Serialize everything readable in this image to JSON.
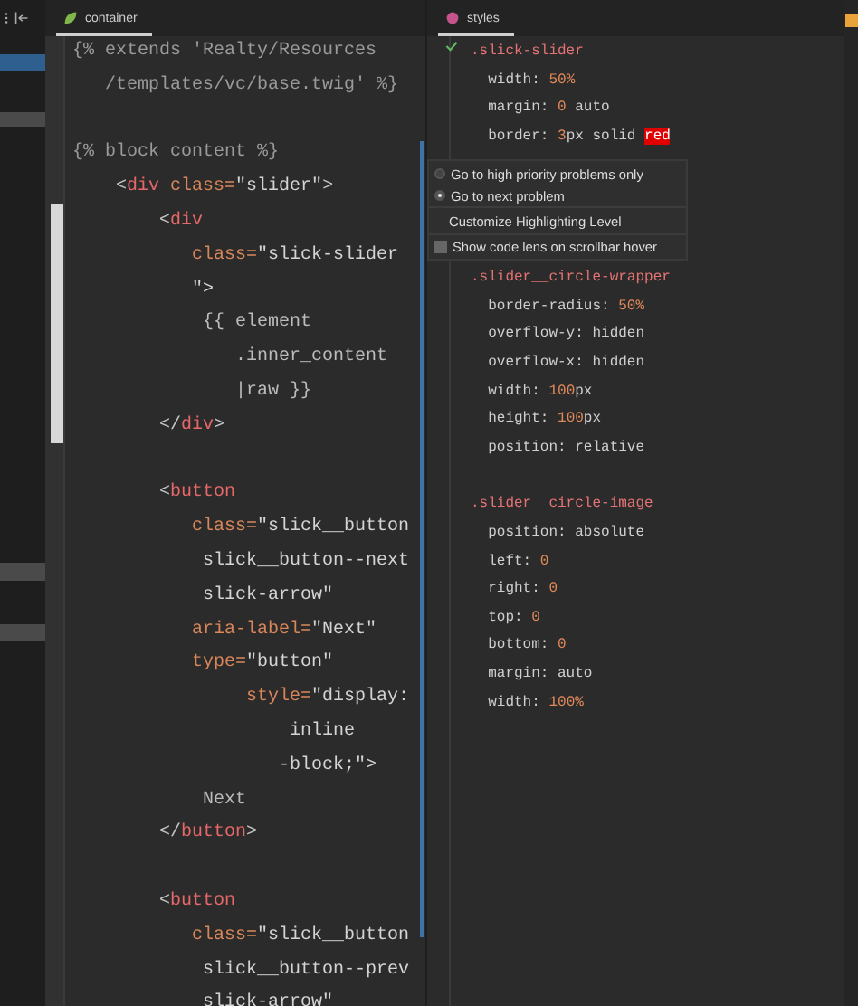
{
  "left_editor": {
    "tab": {
      "label": "container",
      "selected": true
    },
    "lines": [
      [
        {
          "kind": "twig",
          "text": "{% extends 'Realty/Resources"
        }
      ],
      [
        {
          "kind": "twig",
          "text": "   /templates/vc/base.twig' %}"
        }
      ],
      [
        {
          "kind": "blank"
        }
      ],
      [
        {
          "kind": "twig",
          "text": "{% block content %}"
        }
      ],
      [
        {
          "kind": "punct",
          "text": "    <"
        },
        {
          "kind": "tag",
          "text": "div"
        },
        {
          "kind": "attr",
          "text": " class="
        },
        {
          "kind": "str",
          "text": "\"slider\""
        },
        {
          "kind": "punct",
          "text": ">"
        }
      ],
      [
        {
          "kind": "punct",
          "text": "        <"
        },
        {
          "kind": "tag",
          "text": "div"
        }
      ],
      [
        {
          "kind": "attr",
          "text": "           class="
        },
        {
          "kind": "str",
          "text": "\"slick-slider"
        }
      ],
      [
        {
          "kind": "str",
          "text": "           \">"
        }
      ],
      [
        {
          "kind": "text",
          "text": "            {{ element"
        }
      ],
      [
        {
          "kind": "text",
          "text": "               .inner_content"
        }
      ],
      [
        {
          "kind": "text",
          "text": "               |raw }}"
        }
      ],
      [
        {
          "kind": "punct",
          "text": "        </"
        },
        {
          "kind": "tag",
          "text": "div"
        },
        {
          "kind": "punct",
          "text": ">"
        }
      ],
      [
        {
          "kind": "blank"
        }
      ],
      [
        {
          "kind": "punct",
          "text": "        <"
        },
        {
          "kind": "tag",
          "text": "button"
        }
      ],
      [
        {
          "kind": "attr",
          "text": "           class="
        },
        {
          "kind": "str",
          "text": "\"slick__button"
        }
      ],
      [
        {
          "kind": "str",
          "text": "            slick__button--next"
        }
      ],
      [
        {
          "kind": "str",
          "text": "            slick-arrow\""
        }
      ],
      [
        {
          "kind": "attr",
          "text": "           aria-label="
        },
        {
          "kind": "str",
          "text": "\"Next\""
        }
      ],
      [
        {
          "kind": "attr",
          "text": "           type="
        },
        {
          "kind": "str",
          "text": "\"button\""
        }
      ],
      [
        {
          "kind": "attr",
          "text": "                style="
        },
        {
          "kind": "str",
          "text": "\"display:"
        }
      ],
      [
        {
          "kind": "str",
          "text": "                    inline"
        }
      ],
      [
        {
          "kind": "str",
          "text": "                   -block;\">"
        }
      ],
      [
        {
          "kind": "text",
          "text": "            Next"
        }
      ],
      [
        {
          "kind": "punct",
          "text": "        </"
        },
        {
          "kind": "tag",
          "text": "button"
        },
        {
          "kind": "punct",
          "text": ">"
        }
      ],
      [
        {
          "kind": "blank"
        }
      ],
      [
        {
          "kind": "punct",
          "text": "        <"
        },
        {
          "kind": "tag",
          "text": "button"
        }
      ],
      [
        {
          "kind": "attr",
          "text": "           class="
        },
        {
          "kind": "str",
          "text": "\"slick__button"
        }
      ],
      [
        {
          "kind": "str",
          "text": "            slick__button--prev"
        }
      ],
      [
        {
          "kind": "str",
          "text": "            slick-arrow\""
        }
      ]
    ]
  },
  "styles_editor": {
    "tab": {
      "label": "styles",
      "selected": true
    },
    "lines": [
      [
        {
          "kind": "sel",
          "text": ".slick-slider"
        }
      ],
      [
        {
          "kind": "prop",
          "text": "  width: "
        },
        {
          "kind": "num",
          "text": "50%"
        }
      ],
      [
        {
          "kind": "prop",
          "text": "  margin: "
        },
        {
          "kind": "num",
          "text": "0"
        },
        {
          "kind": "prop",
          "text": " auto"
        }
      ],
      [
        {
          "kind": "prop",
          "text": "  border: "
        },
        {
          "kind": "num",
          "text": "3"
        },
        {
          "kind": "prop",
          "text": "px solid "
        },
        {
          "kind": "warn",
          "text": "red"
        }
      ],
      [
        {
          "kind": "sel",
          "text": ".slider__circle-wrapper"
        }
      ],
      [
        {
          "kind": "prop",
          "text": "  border-radius: "
        },
        {
          "kind": "num",
          "text": "50%"
        }
      ],
      [
        {
          "kind": "prop",
          "text": "  overflow-y: hidden"
        }
      ],
      [
        {
          "kind": "prop",
          "text": "  overflow-x: hidden"
        }
      ],
      [
        {
          "kind": "prop",
          "text": "  width: "
        },
        {
          "kind": "num",
          "text": "100"
        },
        {
          "kind": "prop",
          "text": "px"
        }
      ],
      [
        {
          "kind": "prop",
          "text": "  height: "
        },
        {
          "kind": "num",
          "text": "100"
        },
        {
          "kind": "prop",
          "text": "px"
        }
      ],
      [
        {
          "kind": "prop",
          "text": "  position: relative"
        }
      ],
      [
        {
          "kind": "blank"
        }
      ],
      [
        {
          "kind": "sel",
          "text": ".slider__circle-image"
        }
      ],
      [
        {
          "kind": "prop",
          "text": "  position: absolute"
        }
      ],
      [
        {
          "kind": "prop",
          "text": "  left: "
        },
        {
          "kind": "num",
          "text": "0"
        }
      ],
      [
        {
          "kind": "prop",
          "text": "  right: "
        },
        {
          "kind": "num",
          "text": "0"
        }
      ],
      [
        {
          "kind": "prop",
          "text": "  top: "
        },
        {
          "kind": "num",
          "text": "0"
        }
      ],
      [
        {
          "kind": "prop",
          "text": "  bottom: "
        },
        {
          "kind": "num",
          "text": "0"
        }
      ],
      [
        {
          "kind": "prop",
          "text": "  margin: auto"
        }
      ],
      [
        {
          "kind": "prop",
          "text": "  width: "
        },
        {
          "kind": "num",
          "text": "100%"
        }
      ]
    ]
  },
  "popup_menu": {
    "items": [
      {
        "kind": "radio",
        "label": "Go to high priority problems only",
        "selected": false
      },
      {
        "kind": "radio",
        "label": "Go to next problem",
        "selected": true
      },
      {
        "kind": "action",
        "label": "Customize Highlighting Level"
      },
      {
        "kind": "checkbox",
        "label": "Show code lens on scrollbar hover",
        "checked": false
      }
    ]
  }
}
